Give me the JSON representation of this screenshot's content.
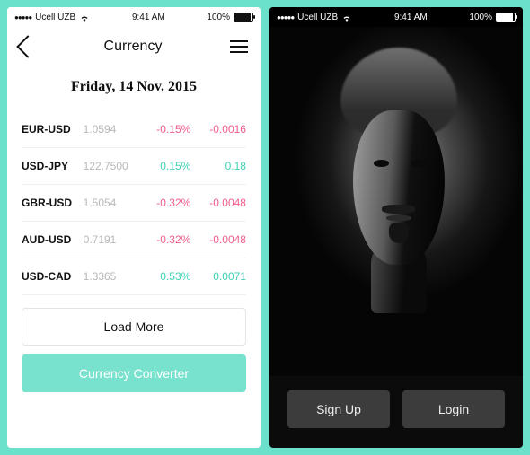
{
  "status": {
    "carrier": "Ucell UZB",
    "time": "9:41 AM",
    "battery": "100%"
  },
  "left": {
    "title": "Currency",
    "date": "Friday, 14 Nov. 2015",
    "rows": [
      {
        "pair": "EUR-USD",
        "rate": "1.0594",
        "pct": "-0.15%",
        "abs": "-0.0016",
        "dir": "neg"
      },
      {
        "pair": "USD-JPY",
        "rate": "122.7500",
        "pct": "0.15%",
        "abs": "0.18",
        "dir": "pos"
      },
      {
        "pair": "GBR-USD",
        "rate": "1.5054",
        "pct": "-0.32%",
        "abs": "-0.0048",
        "dir": "neg"
      },
      {
        "pair": "AUD-USD",
        "rate": "0.7191",
        "pct": "-0.32%",
        "abs": "-0.0048",
        "dir": "neg"
      },
      {
        "pair": "USD-CAD",
        "rate": "1.3365",
        "pct": "0.53%",
        "abs": "0.0071",
        "dir": "pos"
      }
    ],
    "loadmore": "Load More",
    "convert": "Currency Converter"
  },
  "right": {
    "signup": "Sign Up",
    "login": "Login"
  }
}
